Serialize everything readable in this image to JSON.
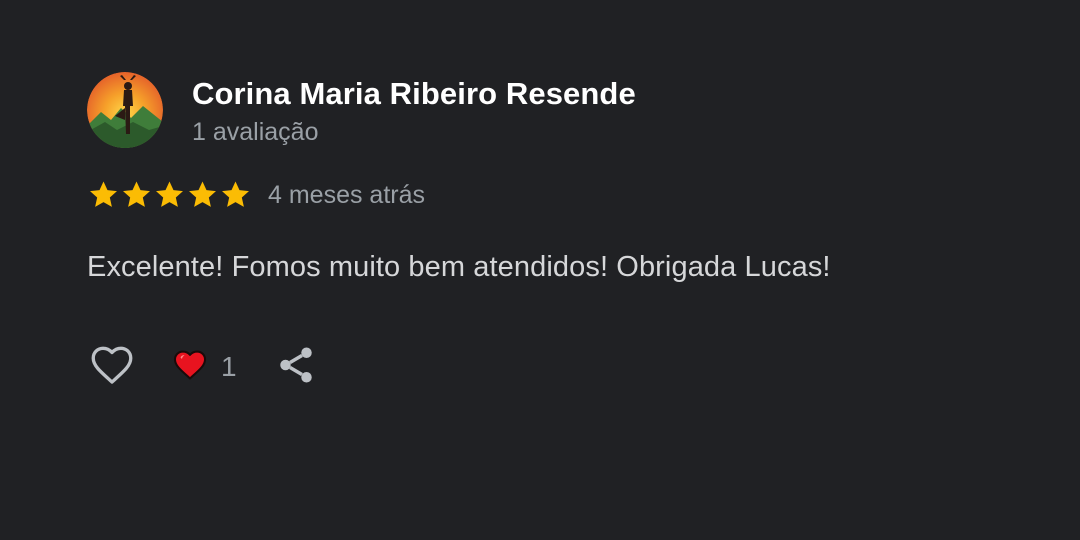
{
  "review": {
    "author_name": "Corina Maria Ribeiro Resende",
    "author_meta": "1 avaliação",
    "rating": 5,
    "rating_max": 5,
    "date": "4 meses atrás",
    "text": "Excelente! Fomos muito bem atendidos! Obrigada Lucas!",
    "reaction_count": "1"
  },
  "icons": {
    "avatar": "yoga-silhouette-sunset-avatar",
    "star": "star-icon",
    "like": "heart-outline-icon",
    "reaction": "heart-filled-icon",
    "share": "share-icon"
  },
  "colors": {
    "background": "#202124",
    "star": "#fbbc04",
    "heart": "#e8131f",
    "muted_text": "#9aa0a6"
  }
}
